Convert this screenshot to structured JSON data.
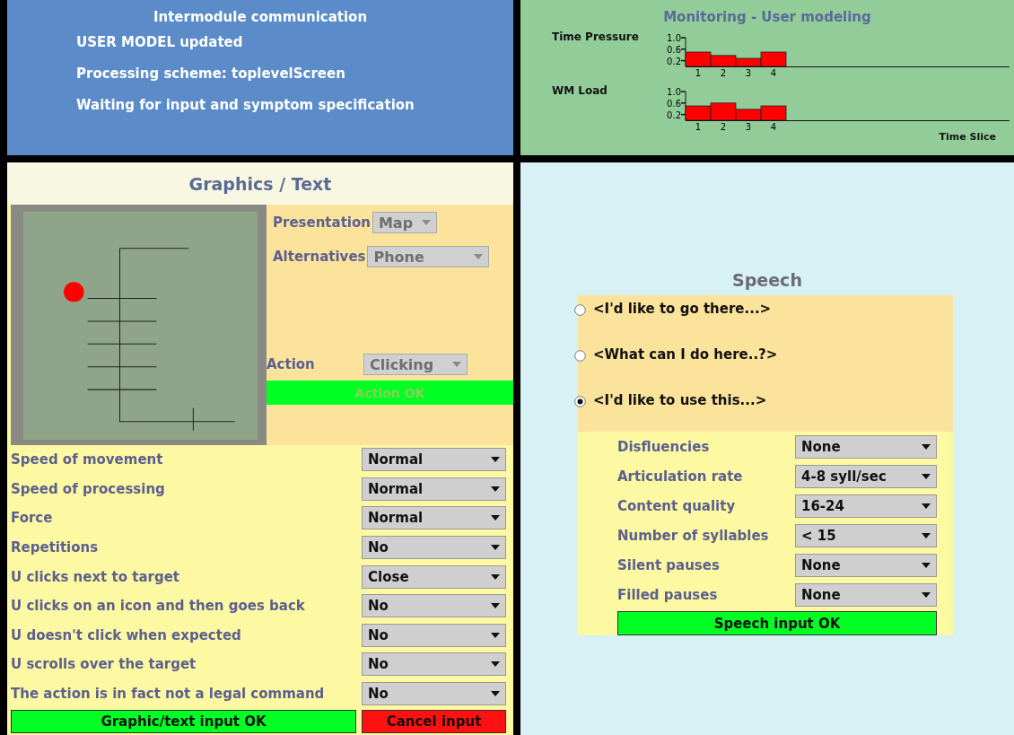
{
  "intermodule": {
    "title": "Intermodule communication",
    "messages": [
      "USER MODEL updated",
      "Processing scheme: toplevelScreen",
      "Waiting for input and symptom specification"
    ]
  },
  "monitoring": {
    "title": "Monitoring - User modeling",
    "charts": [
      {
        "chart_data": {
          "type": "bar",
          "title": "Time Pressure",
          "categories": [
            "1",
            "2",
            "3",
            "4"
          ],
          "values": [
            0.5,
            0.38,
            0.28,
            0.5
          ],
          "ylim": [
            0,
            1
          ],
          "yticks": [
            {
              "value": 0.2,
              "label": "0.2"
            },
            {
              "value": 0.6,
              "label": "0.6"
            },
            {
              "value": 1,
              "label": "1.0"
            }
          ]
        }
      },
      {
        "chart_data": {
          "type": "bar",
          "title": "WM Load",
          "categories": [
            "1",
            "2",
            "3",
            "4"
          ],
          "values": [
            0.5,
            0.6,
            0.38,
            0.5
          ],
          "ylim": [
            0,
            1
          ],
          "yticks": [
            {
              "value": 0.2,
              "label": "0.2"
            },
            {
              "value": 0.6,
              "label": "0.6"
            },
            {
              "value": 1,
              "label": "1.0"
            }
          ]
        }
      }
    ],
    "time_axis_label": "Time Slice"
  },
  "graphics": {
    "title": "Graphics / Text",
    "presentation": {
      "label": "Presentation",
      "value": "Map",
      "disabled": true
    },
    "alternatives": {
      "label": "Alternatives",
      "value": "Phone",
      "disabled": true
    },
    "action": {
      "label": "Action",
      "value": "Clicking",
      "disabled": true
    },
    "action_button": {
      "label": "Action OK",
      "disabled": true
    },
    "fields": [
      {
        "label": "Speed of movement",
        "value": "Normal"
      },
      {
        "label": "Speed of processing",
        "value": "Normal"
      },
      {
        "label": "Force",
        "value": "Normal"
      },
      {
        "label": "Repetitions",
        "value": "No"
      },
      {
        "label": "U clicks next to target",
        "value": "Close"
      },
      {
        "label": "U clicks on an icon and then goes back",
        "value": "No"
      },
      {
        "label": "U doesn't click when expected",
        "value": "No"
      },
      {
        "label": "U scrolls over the target",
        "value": "No"
      },
      {
        "label": "The action is in fact not a legal command",
        "value": "No"
      }
    ],
    "ok_button": "Graphic/text input OK",
    "cancel_button": "Cancel input"
  },
  "speech": {
    "title": "Speech",
    "options": [
      {
        "label": "<I'd like to go there...>",
        "selected": false
      },
      {
        "label": "<What can I do here..?>",
        "selected": false
      },
      {
        "label": "<I'd like to use this...>",
        "selected": true
      }
    ],
    "fields": [
      {
        "label": "Disfluencies",
        "value": "None"
      },
      {
        "label": "Articulation rate",
        "value": "4-8 syll/sec"
      },
      {
        "label": "Content quality",
        "value": "16-24"
      },
      {
        "label": "Number of syllables",
        "value": "< 15"
      },
      {
        "label": "Silent pauses",
        "value": "None"
      },
      {
        "label": "Filled pauses",
        "value": "None"
      }
    ],
    "ok_button": "Speech input OK"
  }
}
